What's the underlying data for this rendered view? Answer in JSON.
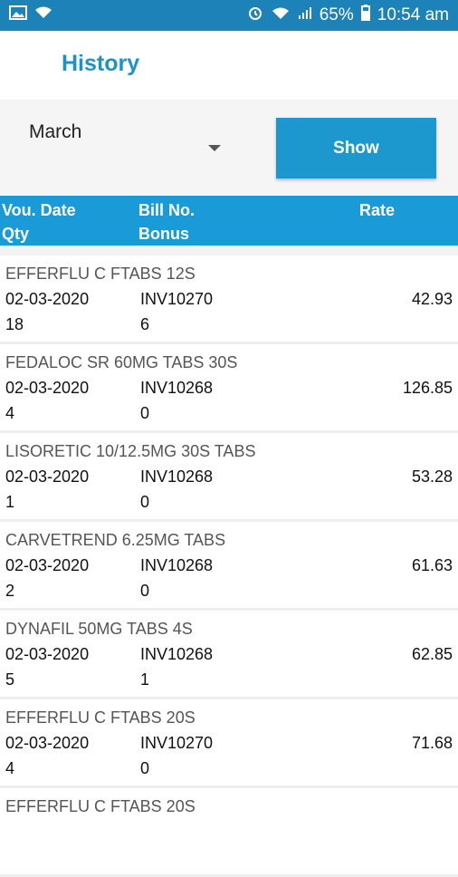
{
  "status_bar": {
    "battery": "65%",
    "time": "10:54 am"
  },
  "header": {
    "title": "History"
  },
  "filter": {
    "month": "March",
    "show_label": "Show"
  },
  "columns": {
    "vou_date": "Vou. Date",
    "bill_no": "Bill No.",
    "rate": "Rate",
    "qty": "Qty",
    "bonus": "Bonus"
  },
  "items": [
    {
      "name": "EFFERFLU C FTABS 12S",
      "date": "02-03-2020",
      "bill": "INV10270",
      "rate": "42.93",
      "qty": "18",
      "bonus": "6"
    },
    {
      "name": "FEDALOC SR 60MG TABS 30S",
      "date": "02-03-2020",
      "bill": "INV10268",
      "rate": "126.85",
      "qty": "4",
      "bonus": "0"
    },
    {
      "name": "LISORETIC 10/12.5MG 30S TABS",
      "date": "02-03-2020",
      "bill": "INV10268",
      "rate": "53.28",
      "qty": "1",
      "bonus": "0"
    },
    {
      "name": "CARVETREND 6.25MG TABS",
      "date": "02-03-2020",
      "bill": "INV10268",
      "rate": "61.63",
      "qty": "2",
      "bonus": "0"
    },
    {
      "name": "DYNAFIL 50MG TABS 4S",
      "date": "02-03-2020",
      "bill": "INV10268",
      "rate": "62.85",
      "qty": "5",
      "bonus": "1"
    },
    {
      "name": "EFFERFLU C FTABS 20S",
      "date": "02-03-2020",
      "bill": "INV10270",
      "rate": "71.68",
      "qty": "4",
      "bonus": "0"
    },
    {
      "name": "EFFERFLU C FTABS 20S",
      "date": "",
      "bill": "",
      "rate": "",
      "qty": "",
      "bonus": ""
    }
  ]
}
